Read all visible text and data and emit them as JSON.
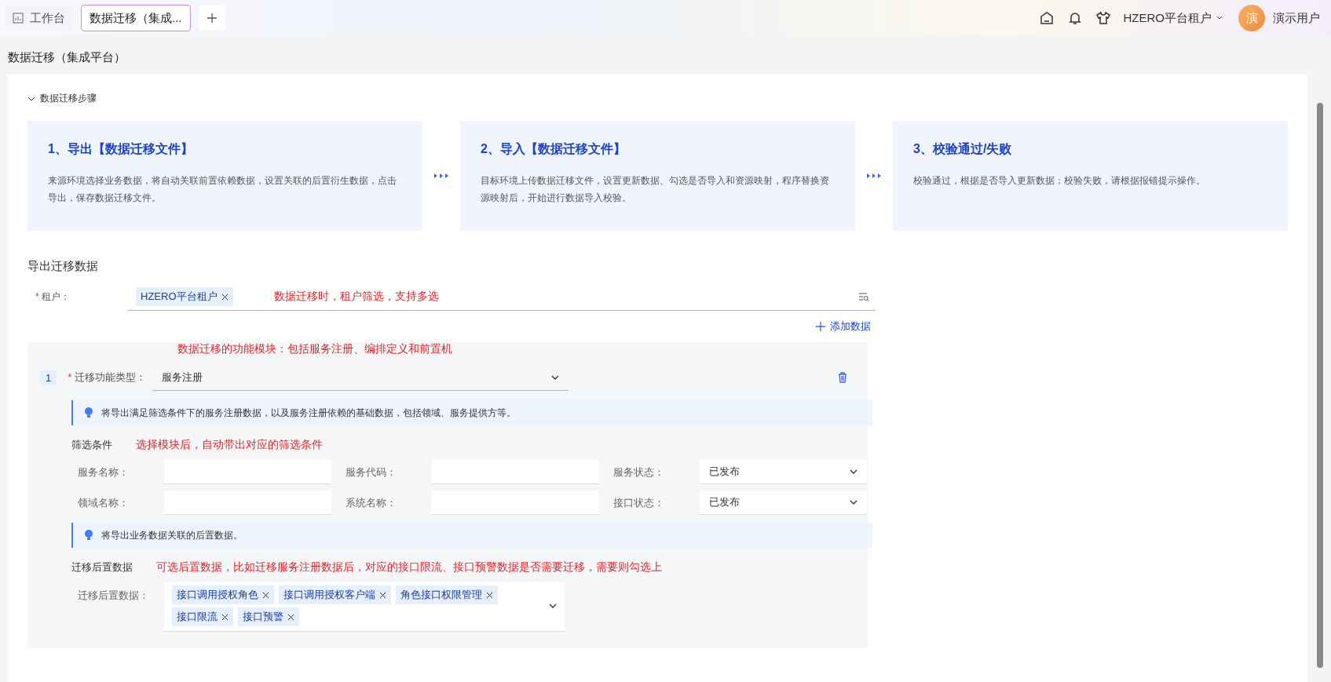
{
  "header": {
    "tabs": [
      {
        "label": "工作台",
        "selected": false
      },
      {
        "label": "数据迁移（集成...",
        "selected": true
      }
    ],
    "tenant": "HZERO平台租户",
    "avatar": "演",
    "user": "演示用户"
  },
  "page_title": "数据迁移（集成平台）",
  "steps_section": {
    "title": "数据迁移步骤",
    "expanded": true,
    "steps": [
      {
        "title": "1、导出【数据迁移文件】",
        "text": "来源环境选择业务数据，将自动关联前置依赖数据，设置关联的后置衍生数据，点击导出，保存数据迁移文件。"
      },
      {
        "title": "2、导入【数据迁移文件】",
        "text": "目标环境上传数据迁移文件，设置更新数据、勾选是否导入和资源映射，程序替换资源映射后，开始进行数据导入校验。"
      },
      {
        "title": "3、校验通过/失败",
        "text": "校验通过，根据是否导入更新数据；校验失败，请根据报错提示操作。"
      }
    ]
  },
  "export": {
    "title": "导出迁移数据",
    "tenant_required_mark": "*",
    "tenant_label": "租户：",
    "tenant_tags": [
      "HZERO平台租户"
    ],
    "tenant_note": "数据迁移时，租户筛选，支持多选",
    "add_button": "添加数据",
    "module_note": "数据迁移的功能模块：包括服务注册、编排定义和前置机",
    "item": {
      "index": "1",
      "type_required_mark": "*",
      "type_label": "迁移功能类型：",
      "type_value": "服务注册",
      "info1": "将导出满足筛选条件下的服务注册数据，以及服务注册依赖的基础数据，包括领域、服务提供方等。",
      "filter_title": "筛选条件",
      "filter_note": "选择模块后，自动带出对应的筛选条件",
      "filters": [
        {
          "label": "服务名称：",
          "kind": "input"
        },
        {
          "label": "服务代码：",
          "kind": "input"
        },
        {
          "label": "服务状态：",
          "kind": "select",
          "value": "已发布"
        },
        {
          "label": "领域名称：",
          "kind": "input"
        },
        {
          "label": "系统名称：",
          "kind": "input"
        },
        {
          "label": "接口状态：",
          "kind": "select",
          "value": "已发布"
        }
      ],
      "info2": "将导出业务数据关联的后置数据。",
      "post_title": "迁移后置数据",
      "post_note": "可选后置数据，比如迁移服务注册数据后，对应的接口限流、接口预警数据是否需要迁移，需要则勾选上",
      "post_label": "迁移后置数据：",
      "post_tags": [
        "接口调用授权角色",
        "接口调用授权客户端",
        "角色接口权限管理",
        "接口限流",
        "接口预警"
      ]
    }
  }
}
